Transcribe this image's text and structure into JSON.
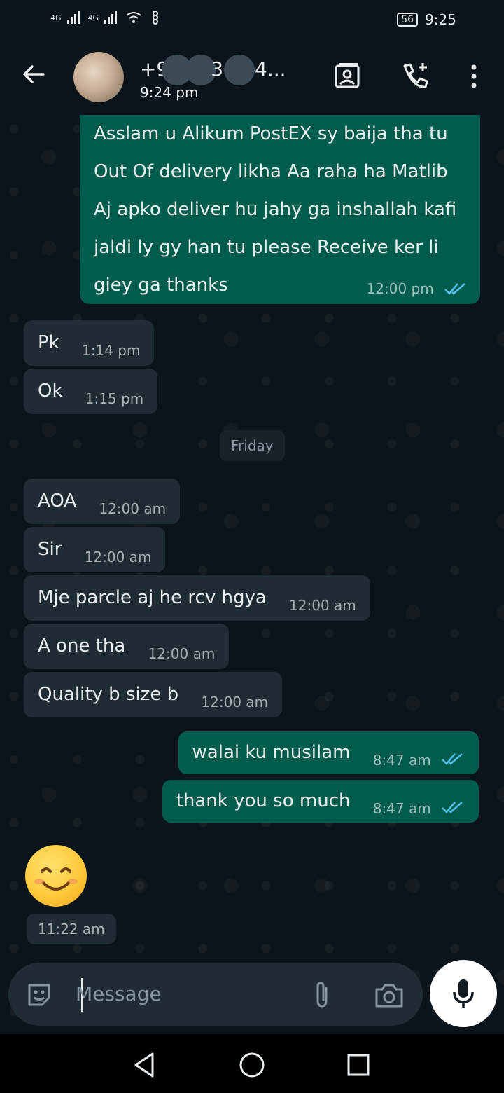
{
  "status_bar": {
    "signal1": "4G",
    "signal2": "4G",
    "battery": "56",
    "time": "9:25"
  },
  "header": {
    "contact_name_prefix": "+9",
    "contact_name_mid": "3(",
    "contact_name_suffix": "4...",
    "last_seen": "9:24 pm"
  },
  "messages": {
    "m1": {
      "text_line1": "Asslam u Alikum PostEX sy baija tha tu",
      "text_line2": "Out Of delivery likha Aa raha ha Matlib",
      "text_line3": "Aj apko deliver hu jahy ga inshallah kafi",
      "text_line4": "jaldi ly gy han tu please Receive ker li",
      "text_line5": "giey ga thanks",
      "time": "12:00 pm"
    },
    "m2": {
      "text": "Pk",
      "time": "1:14 pm"
    },
    "m3": {
      "text": "Ok",
      "time": "1:15 pm"
    },
    "day_separator": "Friday",
    "m4": {
      "text": "AOA",
      "time": "12:00 am"
    },
    "m5": {
      "text": "Sir",
      "time": "12:00 am"
    },
    "m6": {
      "text": "Mje parcle aj he rcv hgya",
      "time": "12:00 am"
    },
    "m7": {
      "text": "A one tha",
      "time": "12:00 am"
    },
    "m8": {
      "text": "Quality b size b",
      "time": "12:00 am"
    },
    "m9": {
      "text": "walai ku musilam",
      "time": "8:47 am"
    },
    "m10": {
      "text": "thank you so much",
      "time": "8:47 am"
    },
    "m11": {
      "time": "11:22 am"
    }
  },
  "composer": {
    "placeholder": "Message"
  },
  "colors": {
    "background": "#0b141a",
    "incoming_bubble": "#202c33",
    "outgoing_bubble": "#005c4b",
    "read_tick": "#53bdeb",
    "text": "#e9edef"
  }
}
